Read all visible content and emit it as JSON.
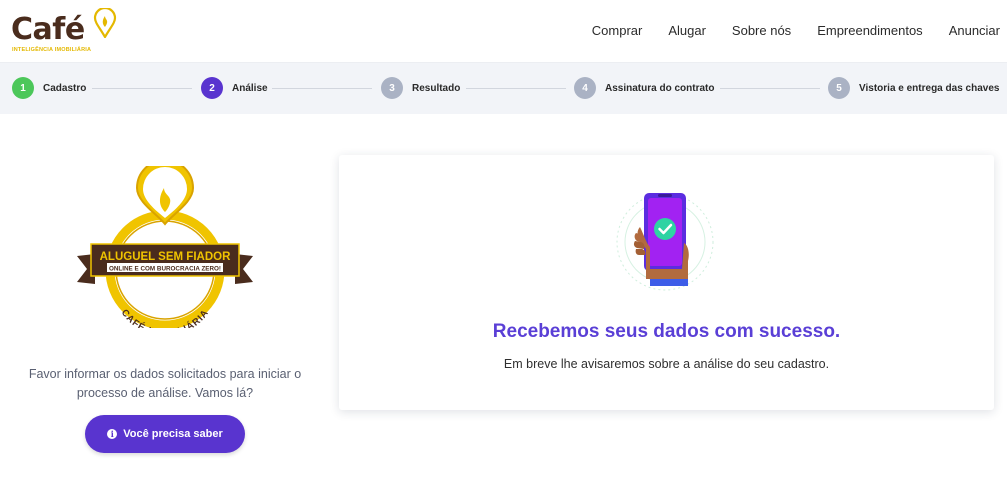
{
  "header": {
    "logo_text": "Café",
    "logo_tagline": "INTELIGÊNCIA IMOBILIÁRIA",
    "nav": [
      "Comprar",
      "Alugar",
      "Sobre nós",
      "Empreendimentos",
      "Anunciar"
    ]
  },
  "stepper": {
    "steps": [
      {
        "number": "1",
        "label": "Cadastro",
        "state": "done",
        "color": "#4cc75a"
      },
      {
        "number": "2",
        "label": "Análise",
        "state": "current",
        "color": "#5934cf"
      },
      {
        "number": "3",
        "label": "Resultado",
        "state": "pending",
        "color": "#aab2c4"
      },
      {
        "number": "4",
        "label": "Assinatura do contrato",
        "state": "pending",
        "color": "#aab2c4"
      },
      {
        "number": "5",
        "label": "Vistoria e entrega das chaves",
        "state": "pending",
        "color": "#aab2c4"
      }
    ]
  },
  "left": {
    "badge": {
      "banner_line1": "ALUGUEL SEM FIADOR",
      "banner_line2": "ONLINE E COM BUROCRACIA ZERO!",
      "ring_text": "CAFÉ IMOBILIÁRIA"
    },
    "message": "Favor informar os dados solicitados para iniciar o processo de análise. Vamos lá?",
    "info_button": "Você precisa saber"
  },
  "card": {
    "illustration": "phone-check-icon",
    "title": "Recebemos seus dados com sucesso.",
    "subtitle": "Em breve lhe avisaremos sobre a análise do seu cadastro."
  },
  "colors": {
    "primary": "#5934cf",
    "title": "#5a3fd6",
    "brand_brown": "#4a2c1d",
    "brand_gold": "#e4b800",
    "success": "#4cc75a"
  }
}
